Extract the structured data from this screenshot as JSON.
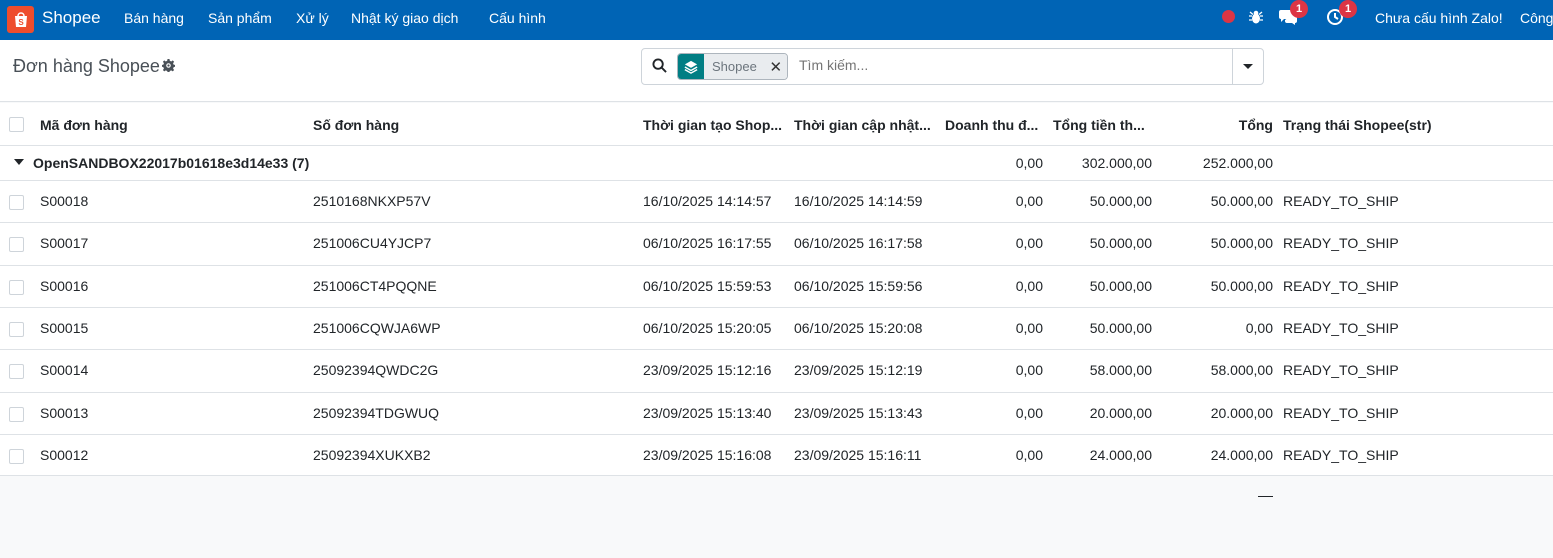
{
  "navbar": {
    "brand": "Shopee",
    "menu": [
      "Bán hàng",
      "Sản phẩm",
      "Xử lý",
      "Nhật ký giao dịch",
      "Cấu hình"
    ],
    "messages_badge": "1",
    "activity_badge": "1",
    "zalo_status": "Chưa cấu hình Zalo!",
    "company": "Công"
  },
  "page": {
    "title": "Đơn hàng Shopee"
  },
  "search": {
    "facet_label": "Shopee",
    "placeholder": "Tìm kiếm..."
  },
  "table": {
    "headers": {
      "order_code": "Mã đơn hàng",
      "order_number": "Số đơn hàng",
      "created": "Thời gian tạo Shop...",
      "updated": "Thời gian cập nhật...",
      "revenue": "Doanh thu đ...",
      "total_amount": "Tổng tiền th...",
      "total": "Tổng",
      "status": "Trạng thái Shopee(str)"
    },
    "group": {
      "label": "OpenSANDBOX22017b01618e3d14e33 (7)",
      "revenue": "0,00",
      "total_amount": "302.000,00",
      "total": "252.000,00"
    },
    "rows": [
      {
        "order_code": "S00018",
        "order_number": "2510168NKXP57V",
        "created": "16/10/2025 14:14:57",
        "updated": "16/10/2025 14:14:59",
        "revenue": "0,00",
        "total_amount": "50.000,00",
        "total": "50.000,00",
        "status": "READY_TO_SHIP"
      },
      {
        "order_code": "S00017",
        "order_number": "251006CU4YJCP7",
        "created": "06/10/2025 16:17:55",
        "updated": "06/10/2025 16:17:58",
        "revenue": "0,00",
        "total_amount": "50.000,00",
        "total": "50.000,00",
        "status": "READY_TO_SHIP"
      },
      {
        "order_code": "S00016",
        "order_number": "251006CT4PQQNE",
        "created": "06/10/2025 15:59:53",
        "updated": "06/10/2025 15:59:56",
        "revenue": "0,00",
        "total_amount": "50.000,00",
        "total": "50.000,00",
        "status": "READY_TO_SHIP"
      },
      {
        "order_code": "S00015",
        "order_number": "251006CQWJA6WP",
        "created": "06/10/2025 15:20:05",
        "updated": "06/10/2025 15:20:08",
        "revenue": "0,00",
        "total_amount": "50.000,00",
        "total": "0,00",
        "status": "READY_TO_SHIP"
      },
      {
        "order_code": "S00014",
        "order_number": "25092394QWDC2G",
        "created": "23/09/2025 15:12:16",
        "updated": "23/09/2025 15:12:19",
        "revenue": "0,00",
        "total_amount": "58.000,00",
        "total": "58.000,00",
        "status": "READY_TO_SHIP"
      },
      {
        "order_code": "S00013",
        "order_number": "25092394TDGWUQ",
        "created": "23/09/2025 15:13:40",
        "updated": "23/09/2025 15:13:43",
        "revenue": "0,00",
        "total_amount": "20.000,00",
        "total": "20.000,00",
        "status": "READY_TO_SHIP"
      },
      {
        "order_code": "S00012",
        "order_number": "25092394XUKXB2",
        "created": "23/09/2025 15:16:08",
        "updated": "23/09/2025 15:16:11",
        "revenue": "0,00",
        "total_amount": "24.000,00",
        "total": "24.000,00",
        "status": "READY_TO_SHIP"
      }
    ]
  },
  "colors": {
    "navbar": "#0064b5",
    "brand_logo": "#ee4d2d",
    "badge": "#dc3545",
    "facet_icon": "#017e84"
  }
}
